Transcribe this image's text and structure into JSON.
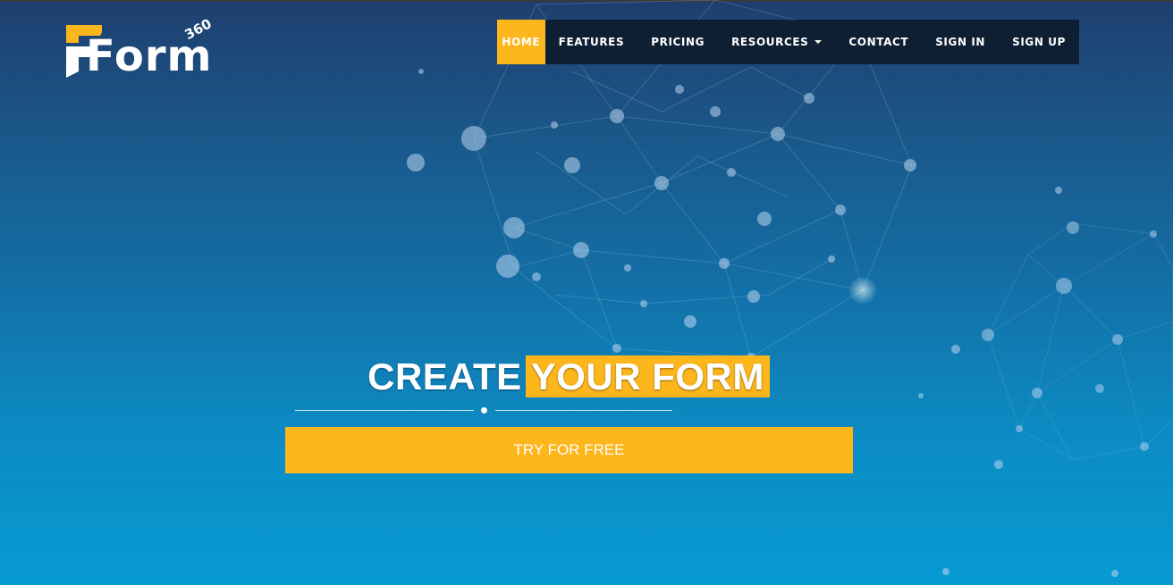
{
  "logo": {
    "text": "Form",
    "badge": "360"
  },
  "nav": {
    "items": [
      {
        "label": "HOME",
        "active": true
      },
      {
        "label": "FEATURES"
      },
      {
        "label": "PRICING"
      },
      {
        "label": "RESOURCES",
        "dropdown": true
      },
      {
        "label": "CONTACT"
      },
      {
        "label": "SIGN IN"
      },
      {
        "label": "SIGN UP"
      }
    ]
  },
  "hero": {
    "title_part1": "CREATE",
    "title_highlight": "YOUR FORM",
    "cta_label": "TRY FOR FREE"
  },
  "colors": {
    "accent": "#fdb61c",
    "nav_background": "#0f1f33",
    "background_top": "#1e3f6e",
    "background_bottom": "#079ad2"
  }
}
